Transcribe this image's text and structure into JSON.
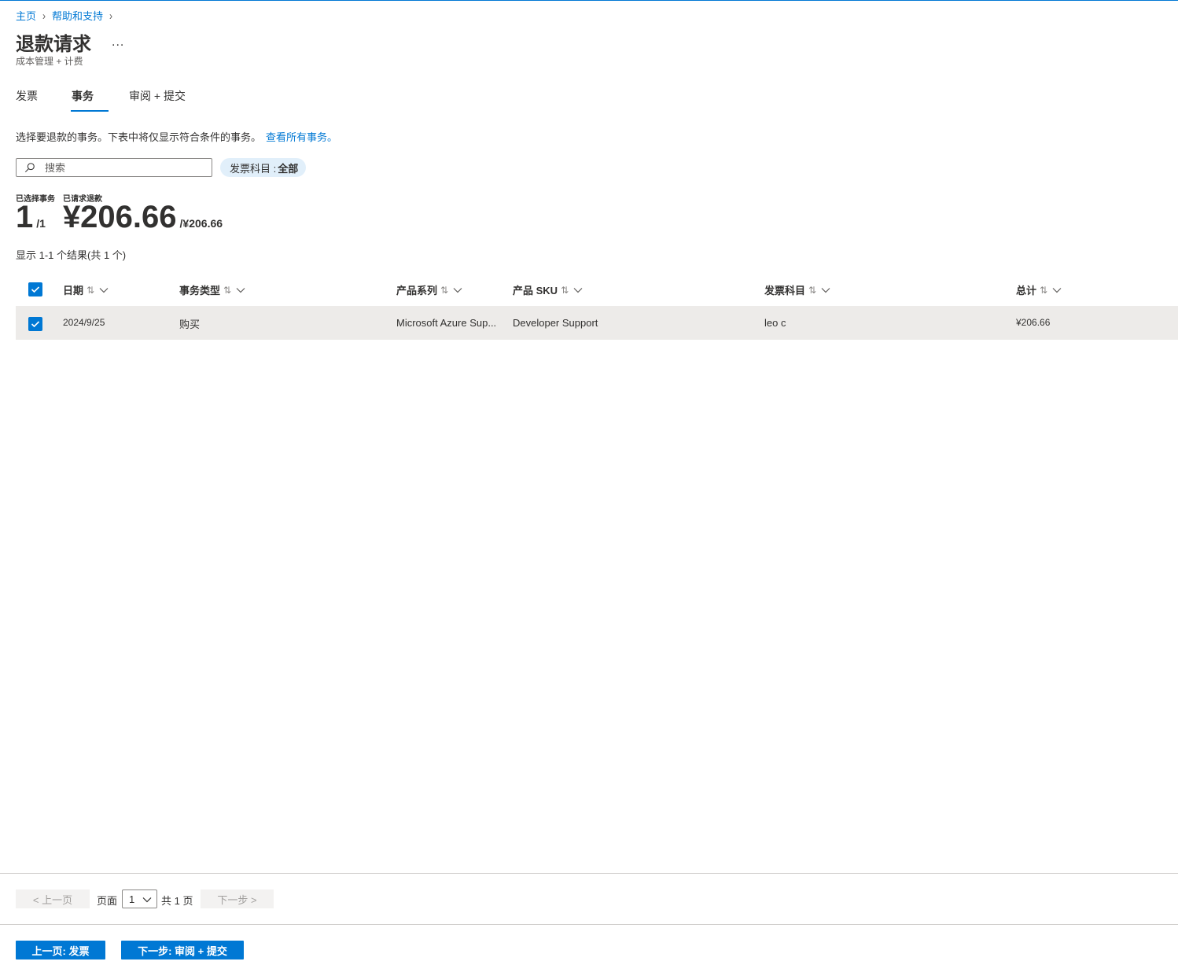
{
  "breadcrumb": {
    "home": "主页",
    "help": "帮助和支持",
    "separator": "›"
  },
  "header": {
    "title": "退款请求",
    "more": "...",
    "subtitle": "成本管理 + 计费"
  },
  "tabs": [
    {
      "label": "发票",
      "active": false
    },
    {
      "label": "事务",
      "active": true
    },
    {
      "label": "审阅 + 提交",
      "active": false
    }
  ],
  "description": {
    "text": "选择要退款的事务。下表中将仅显示符合条件的事务。",
    "link": "查看所有事务。"
  },
  "search": {
    "placeholder": "搜索",
    "value": ""
  },
  "filter": {
    "label": "发票科目 : ",
    "value": "全部"
  },
  "stats": {
    "selected_label": "已选择事务",
    "refund_label": "已请求退款",
    "selected_count": "1",
    "selected_total": "/1",
    "refund_amount": "¥206.66",
    "refund_total": "/¥206.66"
  },
  "results_text": "显示 1-1 个结果(共 1 个)",
  "table": {
    "sort_icon": "⇅",
    "columns": [
      "日期",
      "事务类型",
      "产品系列",
      "产品 SKU",
      "发票科目",
      "总计"
    ],
    "rows": [
      {
        "checked": true,
        "cells": [
          "2024/9/25",
          "购买",
          "Microsoft Azure Sup...",
          "Developer Support",
          "leo c",
          "¥206.66"
        ]
      }
    ]
  },
  "pagination": {
    "prev": "< 上一页",
    "page_label": "页面",
    "page_value": "1",
    "total": "共 1 页",
    "next": "下一步 >"
  },
  "footer": {
    "back": "上一页: 发票",
    "next": "下一步: 审阅 + 提交"
  },
  "colors": {
    "accent": "#0078d4",
    "row_selected": "#edebe9",
    "pill": "#e1effa"
  }
}
